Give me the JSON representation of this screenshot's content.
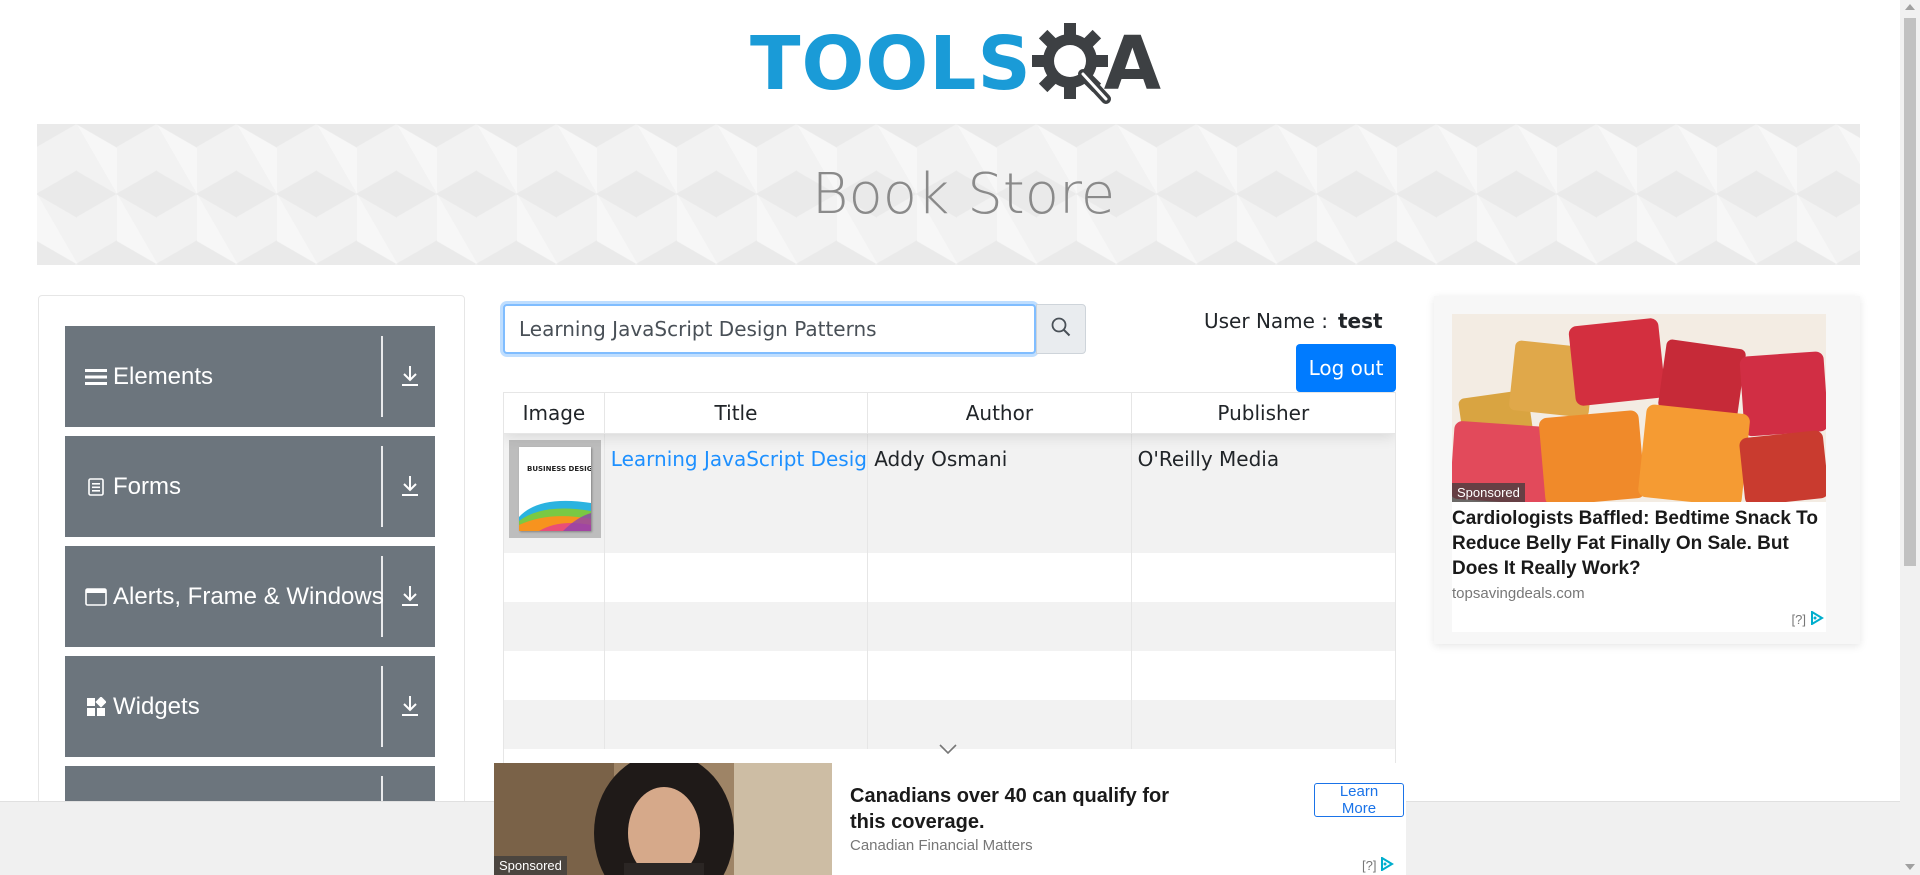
{
  "header": {
    "logo_tools": "TOOLS",
    "logo_a": "A",
    "banner_title": "Book Store"
  },
  "sidebar": {
    "groups": [
      {
        "label": "Elements",
        "icon": "hamburger-icon"
      },
      {
        "label": "Forms",
        "icon": "document-icon"
      },
      {
        "label": "Alerts, Frame & Windows",
        "icon": "window-icon"
      },
      {
        "label": "Widgets",
        "icon": "widgets-icon"
      },
      {
        "label": "",
        "icon": ""
      }
    ],
    "expand_icon": "download-arrow-icon"
  },
  "search": {
    "value": "Learning JavaScript Design Patterns",
    "icon": "search-icon"
  },
  "user": {
    "label": "User Name :",
    "value": "test",
    "logout_label": "Log out"
  },
  "table": {
    "headers": [
      "Image",
      "Title",
      "Author",
      "Publisher"
    ],
    "rows": [
      {
        "cover_text": "BUSINESS DESIGN",
        "title": "Learning JavaScript Design Patterns",
        "author": "Addy Osmani",
        "publisher": "O'Reilly Media"
      }
    ],
    "empty_rows": 4
  },
  "ad_right": {
    "sponsored": "Sponsored",
    "headline": "Cardiologists Baffled: Bedtime Snack To Reduce Belly Fat Finally On Sale. But Does It Really Work?",
    "source": "topsavingdeals.com",
    "adchoice": "[?]"
  },
  "ad_bottom": {
    "sponsored": "Sponsored",
    "headline": "Canadians over 40 can qualify for this coverage.",
    "source": "Canadian Financial Matters",
    "cta": "Learn More",
    "adchoice": "[?]"
  },
  "colors": {
    "logo_blue": "#1a9bd7",
    "logo_dark": "#3d4043",
    "sidebar_bg": "#6c757d",
    "primary_button": "#007bff",
    "link": "#1e90ff"
  }
}
